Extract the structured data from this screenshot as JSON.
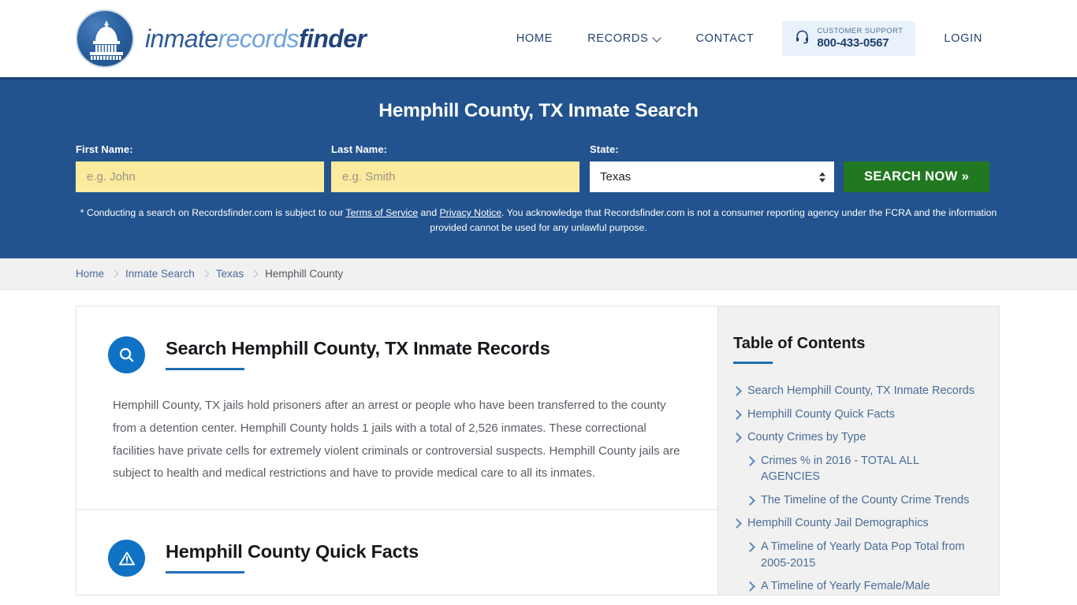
{
  "brand": {
    "logo_part1": "inmate",
    "logo_part2": "records",
    "logo_part3": "finder",
    "logo_icon": "capitol-dome-icon"
  },
  "nav": {
    "items": [
      {
        "label": "HOME",
        "has_chevron": false
      },
      {
        "label": "RECORDS",
        "has_chevron": true
      },
      {
        "label": "CONTACT",
        "has_chevron": false
      }
    ],
    "support": {
      "icon": "headset-icon",
      "label": "CUSTOMER SUPPORT",
      "phone": "800-433-0567"
    },
    "login_label": "LOGIN"
  },
  "hero": {
    "title": "Hemphill County, TX Inmate Search",
    "background_color": "#22538e",
    "first_name": {
      "label": "First Name:",
      "value": "",
      "placeholder": "e.g. John"
    },
    "last_name": {
      "label": "Last Name:",
      "value": "",
      "placeholder": "e.g. Smith"
    },
    "state": {
      "label": "State:",
      "value": "Texas",
      "options": [
        "Texas"
      ]
    },
    "search_button": "SEARCH NOW »",
    "search_button_color": "#217821",
    "disclaimer": {
      "part1": "* Conducting a search on Recordsfinder.com is subject to our ",
      "link1": "Terms of Service",
      "part2": " and ",
      "link2": "Privacy Notice",
      "part3": ". You acknowledge that Recordsfinder.com is not a consumer reporting agency under the FCRA and the information provided cannot be used for any unlawful purpose."
    }
  },
  "breadcrumb": {
    "items": [
      {
        "label": "Home",
        "current": false
      },
      {
        "label": "Inmate Search",
        "current": false
      },
      {
        "label": "Texas",
        "current": false
      },
      {
        "label": "Hemphill County",
        "current": true
      }
    ]
  },
  "main": {
    "sections": [
      {
        "icon": "magnifier-icon",
        "title": "Search Hemphill County, TX Inmate Records",
        "body": "Hemphill County, TX jails hold prisoners after an arrest or people who have been transferred to the county from a detention center. Hemphill County holds 1 jails with a total of 2,526 inmates. These correctional facilities have private cells for extremely violent criminals or controversial suspects. Hemphill County jails are subject to health and medical restrictions and have to provide medical care to all its inmates."
      },
      {
        "icon": "warning-triangle-icon",
        "title": "Hemphill County Quick Facts",
        "body": ""
      }
    ]
  },
  "sidebar": {
    "title": "Table of Contents",
    "accent_color": "#1f6eb5",
    "items": [
      {
        "label": "Search Hemphill County, TX Inmate Records",
        "sub": false
      },
      {
        "label": "Hemphill County Quick Facts",
        "sub": false
      },
      {
        "label": "County Crimes by Type",
        "sub": false
      },
      {
        "label": "Crimes % in 2016 - TOTAL ALL AGENCIES",
        "sub": true
      },
      {
        "label": "The Timeline of the County Crime Trends",
        "sub": true
      },
      {
        "label": "Hemphill County Jail Demographics",
        "sub": false
      },
      {
        "label": "A Timeline of Yearly Data Pop Total from 2005-2015",
        "sub": true
      },
      {
        "label": "A Timeline of Yearly Female/Male",
        "sub": true
      }
    ]
  }
}
